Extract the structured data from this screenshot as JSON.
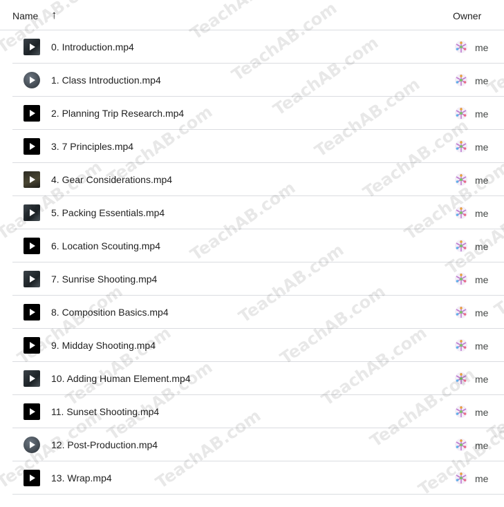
{
  "header": {
    "name_label": "Name",
    "sort_icon": "↑",
    "owner_label": "Owner"
  },
  "files": [
    {
      "name": "0. Introduction.mp4",
      "owner": "me",
      "thumb": "photo"
    },
    {
      "name": "1. Class Introduction.mp4",
      "owner": "me",
      "thumb": "round"
    },
    {
      "name": "2. Planning Trip Research.mp4",
      "owner": "me",
      "thumb": "black"
    },
    {
      "name": "3. 7 Principles.mp4",
      "owner": "me",
      "thumb": "black"
    },
    {
      "name": "4. Gear Considerations.mp4",
      "owner": "me",
      "thumb": "earth"
    },
    {
      "name": "5. Packing Essentials.mp4",
      "owner": "me",
      "thumb": "photo"
    },
    {
      "name": "6. Location Scouting.mp4",
      "owner": "me",
      "thumb": "black"
    },
    {
      "name": "7. Sunrise Shooting.mp4",
      "owner": "me",
      "thumb": "photo"
    },
    {
      "name": "8. Composition Basics.mp4",
      "owner": "me",
      "thumb": "black"
    },
    {
      "name": "9. Midday Shooting.mp4",
      "owner": "me",
      "thumb": "black"
    },
    {
      "name": "10. Adding Human Element.mp4",
      "owner": "me",
      "thumb": "photo"
    },
    {
      "name": "11. Sunset Shooting.mp4",
      "owner": "me",
      "thumb": "black"
    },
    {
      "name": "12. Post-Production.mp4",
      "owner": "me",
      "thumb": "round"
    },
    {
      "name": "13. Wrap.mp4",
      "owner": "me",
      "thumb": "black"
    }
  ],
  "watermark": "TeachAB.com"
}
